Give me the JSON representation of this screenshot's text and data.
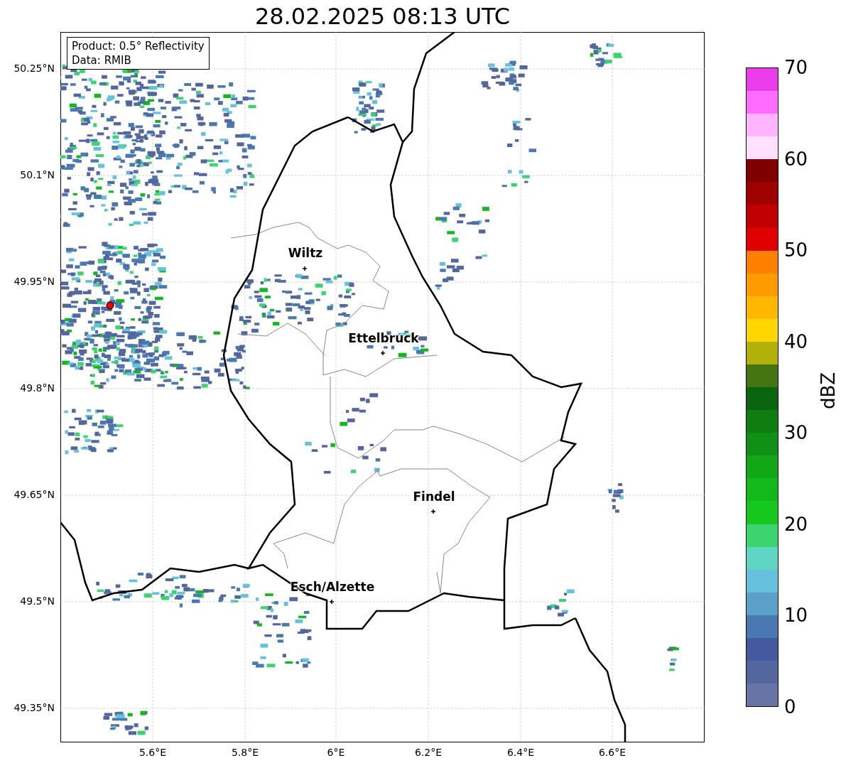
{
  "title": "28.02.2025 08:13 UTC",
  "info_box": [
    "Product: 0.5° Reflectivity",
    "Data: RMIB"
  ],
  "lat_ticks": [
    "50.25°N",
    "50.1°N",
    "49.95°N",
    "49.8°N",
    "49.65°N",
    "49.5°N",
    "49.35°N"
  ],
  "lon_ticks": [
    "5.6°E",
    "5.8°E",
    "6°E",
    "6.2°E",
    "6.4°E",
    "6.6°E"
  ],
  "cities": [
    {
      "name": "Wiltz"
    },
    {
      "name": "Ettelbruck"
    },
    {
      "name": "Findel"
    },
    {
      "name": "Esch/Alzette"
    }
  ],
  "colorbar": {
    "label": "dBZ",
    "ticks": [
      "70",
      "60",
      "50",
      "40",
      "30",
      "20",
      "10",
      "0"
    ],
    "bins": [
      {
        "color": "#ea3cea"
      },
      {
        "color": "#ff6cff"
      },
      {
        "color": "#ffb4ff"
      },
      {
        "color": "#ffe0ff"
      },
      {
        "color": "#800000"
      },
      {
        "color": "#a00000"
      },
      {
        "color": "#c00000"
      },
      {
        "color": "#e00000"
      },
      {
        "color": "#ff7f00"
      },
      {
        "color": "#ff9a00"
      },
      {
        "color": "#ffb700"
      },
      {
        "color": "#ffd700"
      },
      {
        "color": "#b1b10a"
      },
      {
        "color": "#457510"
      },
      {
        "color": "#0a6410"
      },
      {
        "color": "#0e7e12"
      },
      {
        "color": "#109014"
      },
      {
        "color": "#12a716"
      },
      {
        "color": "#12b91a"
      },
      {
        "color": "#14c81e"
      },
      {
        "color": "#3cd46e"
      },
      {
        "color": "#5fd6c4"
      },
      {
        "color": "#66c2dc"
      },
      {
        "color": "#5aa0c8"
      },
      {
        "color": "#4a78b0"
      },
      {
        "color": "#445aa0"
      },
      {
        "color": "#53679e"
      },
      {
        "color": "#6674a6"
      }
    ]
  }
}
